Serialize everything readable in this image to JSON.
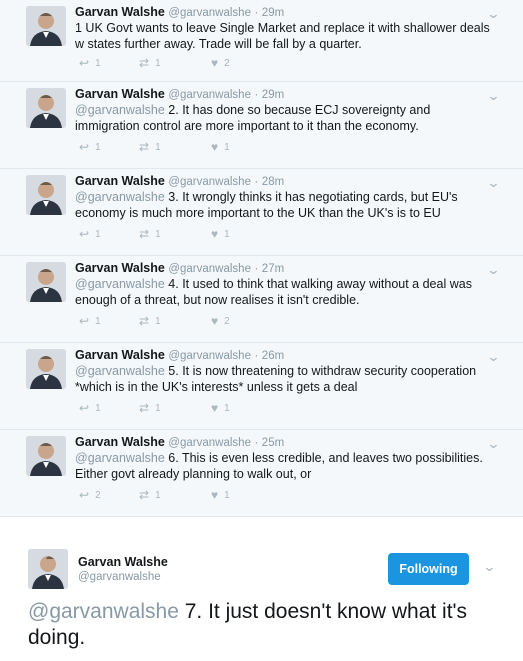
{
  "tweets": [
    {
      "name": "Garvan Walshe",
      "handle": "@garvanwalshe",
      "sep": "·",
      "time": "29m",
      "mention": "",
      "text": "1 UK Govt wants to leave Single Market and replace it with shallower deals w states further away. Trade will be fall by a quarter.",
      "replies": "1",
      "retweets": "1",
      "likes": "2"
    },
    {
      "name": "Garvan Walshe",
      "handle": "@garvanwalshe",
      "sep": "·",
      "time": "29m",
      "mention": "@garvanwalshe",
      "text": " 2. It has done so because ECJ sovereignty and immigration control are more important to it than the economy.",
      "replies": "1",
      "retweets": "1",
      "likes": "1"
    },
    {
      "name": "Garvan Walshe",
      "handle": "@garvanwalshe",
      "sep": "·",
      "time": "28m",
      "mention": "@garvanwalshe",
      "text": " 3. It wrongly thinks it has negotiating cards, but  EU's economy is much more important to the UK than the UK's is to EU",
      "replies": "1",
      "retweets": "1",
      "likes": "1"
    },
    {
      "name": "Garvan Walshe",
      "handle": "@garvanwalshe",
      "sep": "·",
      "time": "27m",
      "mention": "@garvanwalshe",
      "text": " 4. It used to think that walking away without a deal was enough of a threat, but now realises it isn't credible.",
      "replies": "1",
      "retweets": "1",
      "likes": "2"
    },
    {
      "name": "Garvan Walshe",
      "handle": "@garvanwalshe",
      "sep": "·",
      "time": "26m",
      "mention": "@garvanwalshe",
      "text": " 5. It is now threatening to withdraw security cooperation *which is in the UK's interests* unless it gets a deal",
      "replies": "1",
      "retweets": "1",
      "likes": "1"
    },
    {
      "name": "Garvan Walshe",
      "handle": "@garvanwalshe",
      "sep": "·",
      "time": "25m",
      "mention": "@garvanwalshe",
      "text": " 6. This is even less credible, and leaves two possibilities. Either govt already planning to walk out, or",
      "replies": "2",
      "retweets": "1",
      "likes": "1"
    }
  ],
  "main_tweet": {
    "name": "Garvan Walshe",
    "handle": "@garvanwalshe",
    "follow_label": "Following",
    "mention": "@garvanwalshe",
    "text": " 7. It just doesn't know what it's doing."
  },
  "colors": {
    "accent": "#1b95e0",
    "thread_bg": "#f5f8fa",
    "muted": "#8899a6"
  },
  "icons": {
    "reply": "reply-icon",
    "retweet": "retweet-icon",
    "like": "heart-icon",
    "caret": "chevron-down-icon"
  }
}
